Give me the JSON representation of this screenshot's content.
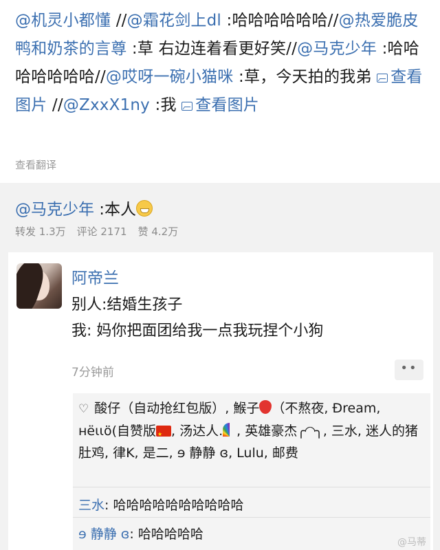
{
  "chain": {
    "s1_user": "@机灵小都懂",
    "s1_sep": " //",
    "s2_user": "@霜花剑上dl",
    "s2_text": " :哈哈哈哈哈哈//",
    "s3_user": "@热爱脆皮鸭和奶茶的言尊",
    "s3_text": " :草 右边连着看更好笑//",
    "s4_user": "@马克少年",
    "s4_text": " :哈哈哈哈哈哈哈//",
    "s5_user": "@哎呀一碗小猫咪",
    "s5_text": " :草，今天拍的我弟 ",
    "s5_img": "查看图片",
    "s6_sep": " //",
    "s6_user": "@ZxxX1ny",
    "s6_text": " :我 ",
    "s6_img": "查看图片"
  },
  "translate_label": "查看翻译",
  "origin": {
    "user": "@马克少年",
    "text": " :本人",
    "emoji": "grin-emoji"
  },
  "stats": {
    "repost": "转发 1.3万",
    "comment": "评论 2171",
    "like": "赞 4.2万"
  },
  "comment": {
    "name": "阿帝兰",
    "line1": "别人:结婚生孩子",
    "line2": "我: 妈你把面团给我一点我玩捏个小狗",
    "time": "7分钟前",
    "more": "••"
  },
  "likes": {
    "icon": "heart-icon",
    "p1": "酸仔（自动抢红包版）, 鯸子",
    "p2": "（不熬夜, Đream, нёιιö(自赞版",
    "p3": ", 汤达人.",
    "p4": ", 英雄豪杰",
    "p5": "╭◜◝╮",
    "p6": ", 三水, 迷人的猪肚鸡, 律K, 是二, ɘ 静静 ɞ, Lulu, 邮费"
  },
  "replies": [
    {
      "user": "三水",
      "text": ": 哈哈哈哈哈哈哈哈哈哈"
    },
    {
      "user": "ɘ 静静 ɞ",
      "text": ": 哈哈哈哈哈"
    }
  ],
  "watermark": "@马蒂"
}
